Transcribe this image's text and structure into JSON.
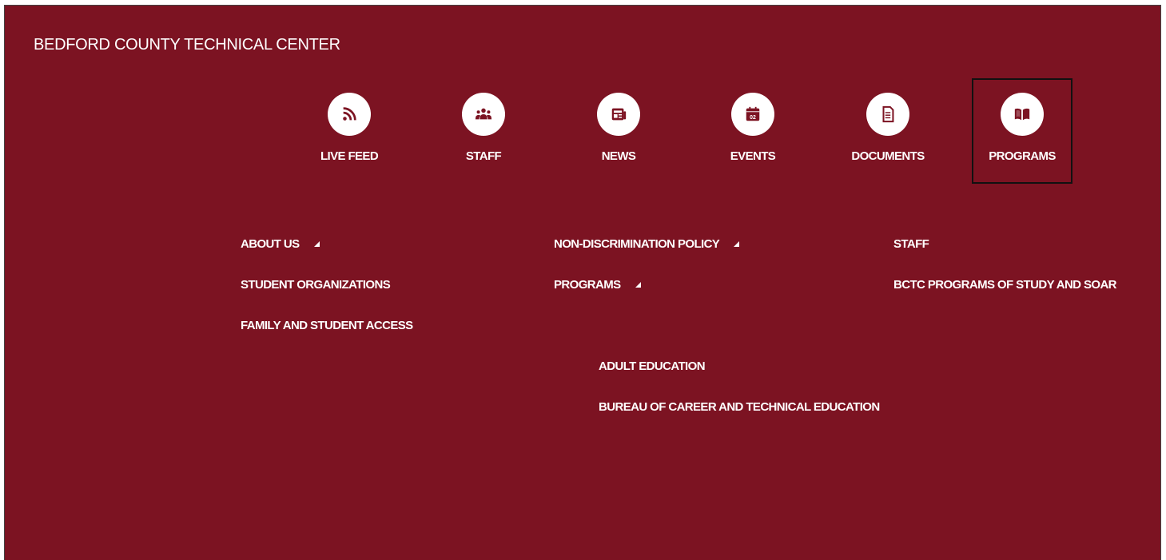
{
  "site": {
    "title": "BEDFORD COUNTY TECHNICAL CENTER"
  },
  "nav": {
    "selected": "PROGRAMS",
    "items": [
      {
        "label": "LIVE FEED",
        "icon": "rss-icon"
      },
      {
        "label": "STAFF",
        "icon": "people-icon"
      },
      {
        "label": "NEWS",
        "icon": "newspaper-icon"
      },
      {
        "label": "EVENTS",
        "icon": "calendar-icon",
        "icon_text": "02"
      },
      {
        "label": "DOCUMENTS",
        "icon": "document-icon"
      },
      {
        "label": "PROGRAMS",
        "icon": "book-icon"
      }
    ]
  },
  "menu": {
    "col1": [
      {
        "label": "ABOUT US",
        "has_submenu": true
      },
      {
        "label": "STUDENT ORGANIZATIONS",
        "has_submenu": false
      },
      {
        "label": "FAMILY AND STUDENT ACCESS",
        "has_submenu": false
      }
    ],
    "col2": [
      {
        "label": "NON-DISCRIMINATION POLICY",
        "has_submenu": true
      },
      {
        "label": "PROGRAMS",
        "has_submenu": true
      }
    ],
    "col3": [
      {
        "label": "STAFF",
        "has_submenu": false
      },
      {
        "label": "BCTC PROGRAMS OF STUDY AND SOAR",
        "has_submenu": false
      }
    ],
    "submenu": [
      {
        "label": "ADULT EDUCATION"
      },
      {
        "label": "BUREAU OF CAREER AND TECHNICAL EDUCATION"
      }
    ]
  },
  "colors": {
    "background": "#7c1322",
    "text": "#ffffff",
    "icon": "#7c1322"
  }
}
